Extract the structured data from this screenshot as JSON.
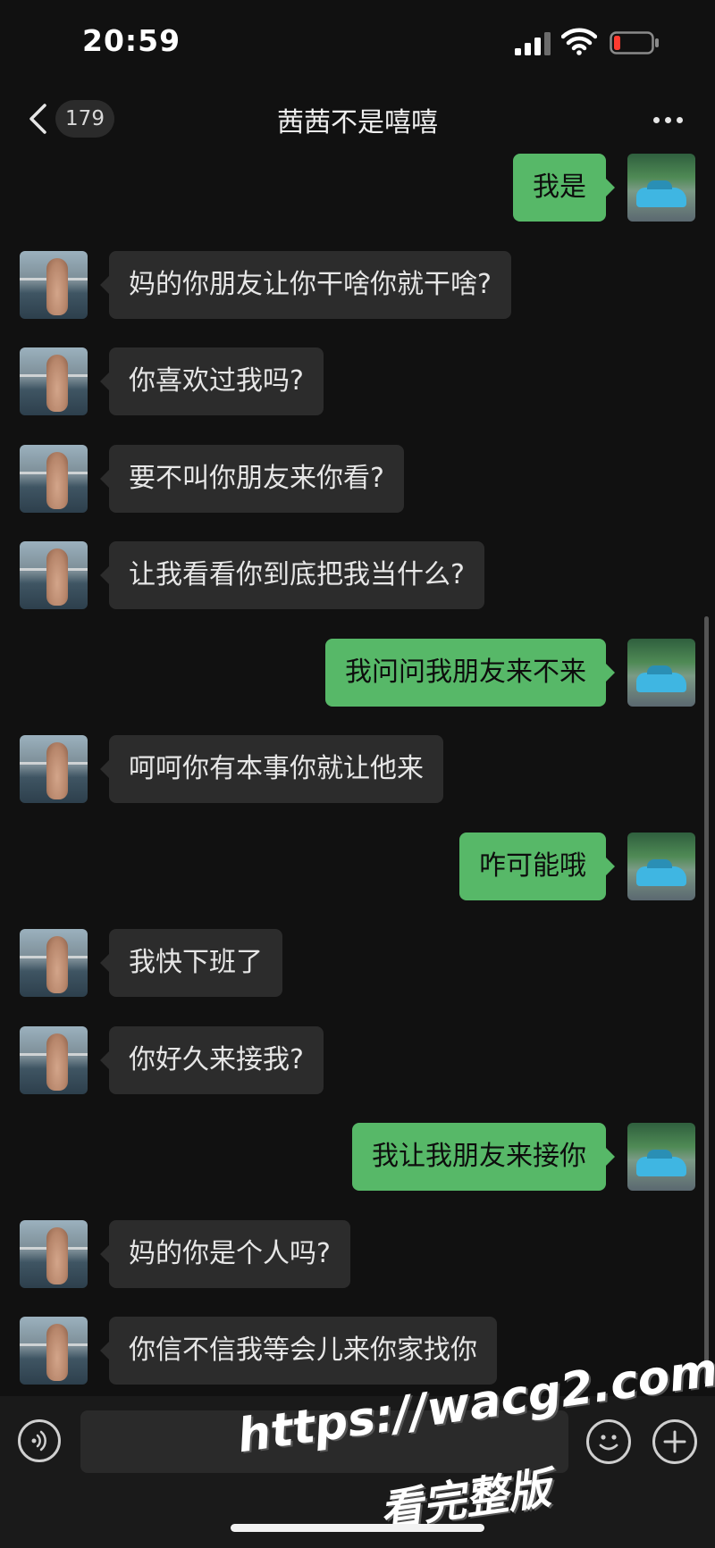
{
  "status_bar": {
    "time": "20:59"
  },
  "nav": {
    "badge": "179",
    "title": "茜茜不是嘻嘻"
  },
  "messages": [
    {
      "side": "sent",
      "text": "我是"
    },
    {
      "side": "recv",
      "text": "妈的你朋友让你干啥你就干啥?"
    },
    {
      "side": "recv",
      "text": "你喜欢过我吗?"
    },
    {
      "side": "recv",
      "text": "要不叫你朋友来你看?"
    },
    {
      "side": "recv",
      "text": "让我看看你到底把我当什么?"
    },
    {
      "side": "sent",
      "text": "我问问我朋友来不来"
    },
    {
      "side": "recv",
      "text": "呵呵你有本事你就让他来"
    },
    {
      "side": "sent",
      "text": "咋可能哦"
    },
    {
      "side": "recv",
      "text": "我快下班了"
    },
    {
      "side": "recv",
      "text": "你好久来接我?"
    },
    {
      "side": "sent",
      "text": "我让我朋友来接你"
    },
    {
      "side": "recv",
      "text": "妈的你是个人吗?"
    },
    {
      "side": "recv",
      "text": "你信不信我等会儿来你家找你"
    }
  ],
  "watermark": {
    "url": "https://wacg2.com",
    "subtitle": "看完整版"
  },
  "colors": {
    "background": "#111111",
    "sent_bubble": "#57b868",
    "received_bubble": "#2c2c2c"
  }
}
